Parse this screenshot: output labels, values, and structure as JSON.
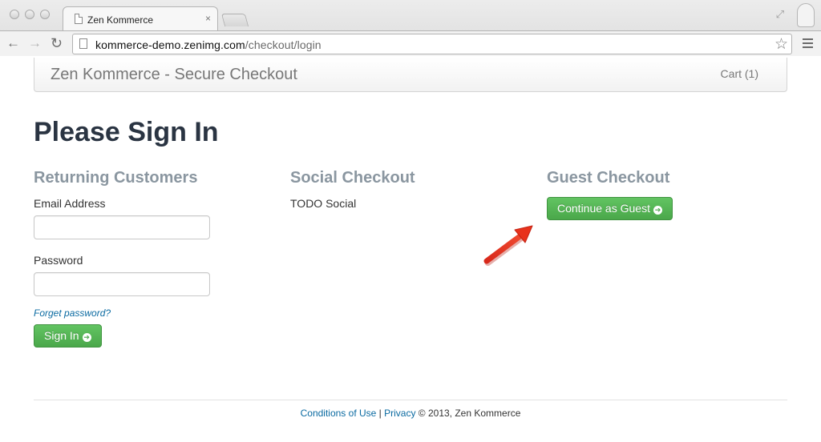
{
  "browser": {
    "tab_title": "Zen Kommerce",
    "tab_close": "×",
    "url_host": "kommerce-demo.zenimg.com",
    "url_path": "/checkout/login",
    "nav_back": "←",
    "nav_forward": "→",
    "nav_reload": "↻",
    "star": "☆",
    "resize": "⤢"
  },
  "navbar": {
    "brand": "Zen Kommerce - Secure Checkout",
    "cart": "Cart (1)"
  },
  "page": {
    "title": "Please Sign In"
  },
  "returning": {
    "heading": "Returning Customers",
    "email_label": "Email Address",
    "email_value": "",
    "password_label": "Password",
    "password_value": "",
    "forgot_link": "Forget password?",
    "sign_in_button": "Sign In",
    "button_icon": "➔"
  },
  "social": {
    "heading": "Social Checkout",
    "text": "TODO Social"
  },
  "guest": {
    "heading": "Guest Checkout",
    "button": "Continue as Guest",
    "button_icon": "➔"
  },
  "footer": {
    "conditions": "Conditions of Use",
    "separator": " | ",
    "privacy": "Privacy",
    "copyright": " © 2013, Zen Kommerce"
  },
  "colors": {
    "button_green": "#5cb85c",
    "heading_gray": "#8a96a0",
    "link_blue": "#0a6aa1",
    "annotation_arrow": "#e8321c"
  }
}
